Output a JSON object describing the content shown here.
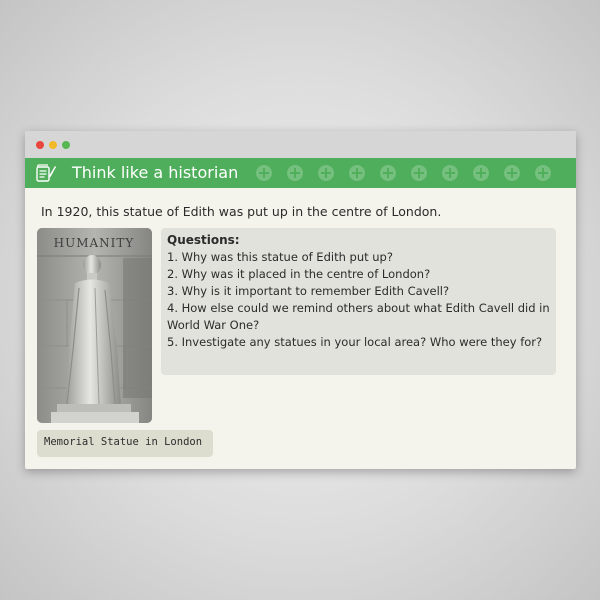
{
  "window": {
    "traffic_lights": [
      "#e9463d",
      "#f2b929",
      "#56b64f"
    ]
  },
  "banner": {
    "title": "Think like a historian",
    "icon": "scroll-quill-icon",
    "pattern_icon": "plus-circle-icon",
    "color": "#4fae5b"
  },
  "intro_text": "In 1920, this statue of Edith was put up in the centre of London.",
  "image": {
    "inscription": "HUMANITY",
    "caption": "Memorial Statue in London"
  },
  "questions": {
    "heading": "Questions:",
    "items": [
      "1. Why was this statue of Edith put up?",
      "2. Why was it placed in the centre of London?",
      "3. Why is it important to remember Edith Cavell?",
      "4. How else could we remind others about what Edith Cavell did in World War One?",
      "5. Investigate any statues in your local area? Who were they for?"
    ]
  }
}
